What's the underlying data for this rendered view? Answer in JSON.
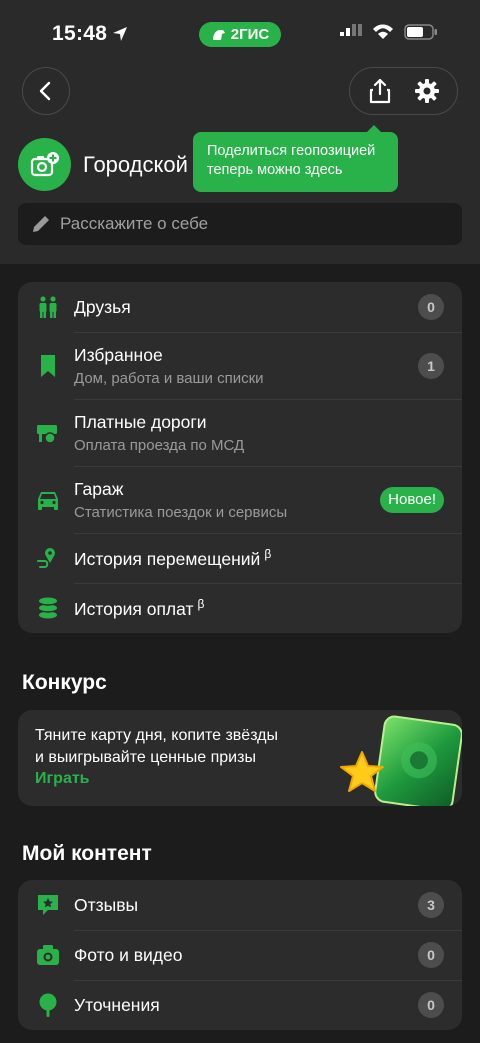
{
  "status_bar": {
    "time": "15:48",
    "brand": "2ГИС"
  },
  "profile": {
    "name": "Городской",
    "about_placeholder": "Расскажите о себе",
    "tooltip": [
      "Поделиться геопозицией",
      "теперь можно здесь"
    ]
  },
  "menu": [
    {
      "title": "Друзья",
      "subtitle": "",
      "badge": "0",
      "icon": "friends-icon"
    },
    {
      "title": "Избранное",
      "subtitle": "Дом, работа и ваши списки",
      "badge": "1",
      "icon": "bookmark-icon"
    },
    {
      "title": "Платные дороги",
      "subtitle": "Оплата проезда по МСД",
      "badge": "",
      "icon": "toll-road-icon"
    },
    {
      "title": "Гараж",
      "subtitle": "Статистика поездок и сервисы",
      "new_badge": "Новое!",
      "icon": "car-icon"
    },
    {
      "title": "История перемещений",
      "beta": "β",
      "icon": "location-history-icon"
    },
    {
      "title": "История оплат",
      "beta": "β",
      "icon": "coins-icon"
    }
  ],
  "contest": {
    "section_title": "Конкурс",
    "text_line1": "Тяните карту дня, копите звёзды",
    "text_line2": "и выигрывайте ценные призы",
    "link": "Играть"
  },
  "content": {
    "section_title": "Мой контент",
    "items": [
      {
        "title": "Отзывы",
        "badge": "3",
        "icon": "review-icon"
      },
      {
        "title": "Фото и видео",
        "badge": "0",
        "icon": "camera-icon"
      },
      {
        "title": "Уточнения",
        "badge": "0",
        "icon": "pin-icon"
      }
    ]
  },
  "colors": {
    "accent": "#29b24a",
    "background": "#1c1c1c",
    "card": "#2c2c2c"
  }
}
